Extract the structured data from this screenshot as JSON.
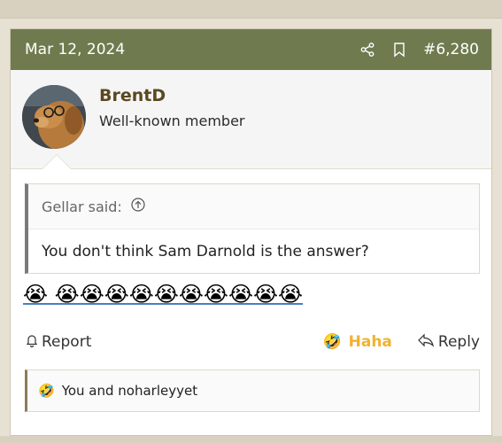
{
  "post": {
    "date": "Mar 12, 2024",
    "post_number": "#6,280",
    "icons": {
      "share": "share-icon",
      "bookmark": "bookmark-icon"
    }
  },
  "user": {
    "name": "BrentD",
    "title": "Well-known member"
  },
  "quote": {
    "author": "Gellar said:",
    "text": "You don't think Sam Darnold is the answer?"
  },
  "message": {
    "emojis": "😭 😭😭😭😭😭😭😭😭😭😭"
  },
  "actions": {
    "report_label": "Report",
    "reaction_label": "Haha",
    "reaction_emoji": "🤣",
    "reply_label": "Reply"
  },
  "reactions_summary": {
    "emoji": "🤣",
    "text": "You and noharleyyet"
  },
  "colors": {
    "header_bg": "#6f7b4f",
    "username": "#5a4820",
    "haha": "#f2b230"
  }
}
